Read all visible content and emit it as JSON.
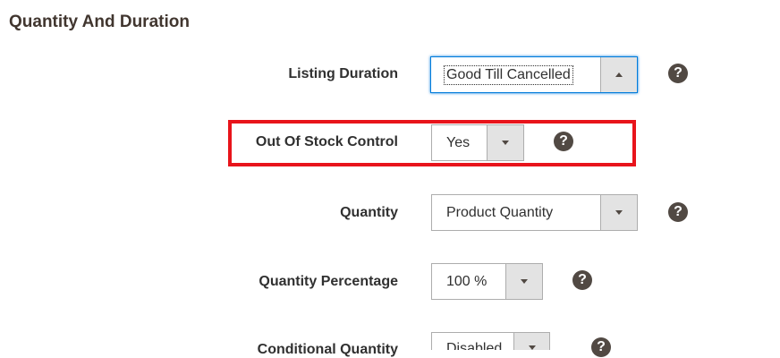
{
  "section": {
    "title": "Quantity And Duration"
  },
  "rows": {
    "listing_duration": {
      "label": "Listing Duration",
      "value": "Good Till Cancelled"
    },
    "out_of_stock_control": {
      "label": "Out Of Stock Control",
      "value": "Yes"
    },
    "quantity": {
      "label": "Quantity",
      "value": "Product Quantity"
    },
    "quantity_percentage": {
      "label": "Quantity Percentage",
      "value": "100 %"
    },
    "conditional_quantity": {
      "label": "Conditional Quantity",
      "value": "Disabled"
    }
  },
  "help_glyph": "?",
  "colors": {
    "highlight": "#e8141b",
    "focus": "#007bdb",
    "help_icon": "#514943"
  }
}
